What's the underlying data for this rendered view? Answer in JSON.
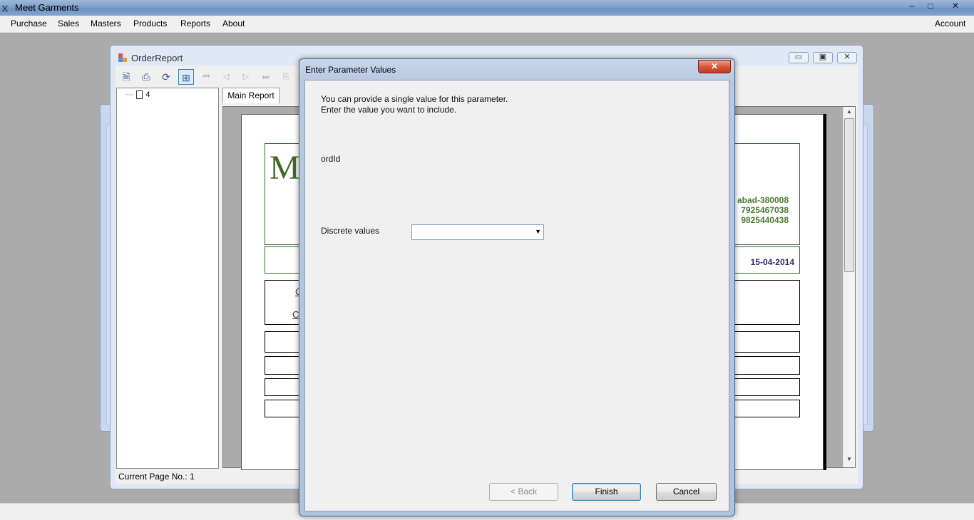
{
  "app": {
    "title": "Meet Garments",
    "window_buttons": [
      "–",
      "□",
      "✕"
    ]
  },
  "menu": {
    "items": [
      "Purchase",
      "Sales",
      "Masters",
      "Products",
      "Reports",
      "About"
    ],
    "account": "Account"
  },
  "report_window": {
    "title": "OrderReport",
    "tree_node": "4",
    "tab_label": "Main Report",
    "status": "Current Page No.: 1",
    "report_preview": {
      "logo_letter": "M",
      "address_line": "abad-380008",
      "phone1": "7925467038",
      "phone2": "9825440438",
      "date": "15-04-2014",
      "link1": "C",
      "link2": "C"
    }
  },
  "dialog": {
    "title": "Enter Parameter Values",
    "close_label": "✕",
    "info_line1": "You can provide a single value for this parameter.",
    "info_line2": "Enter the value you want to include.",
    "parameter_name": "ordId",
    "discrete_label": "Discrete values",
    "discrete_value": "",
    "buttons": {
      "back": "< Back",
      "finish": "Finish",
      "cancel": "Cancel"
    }
  },
  "colors": {
    "accent": "#3c7fb1",
    "report_green": "#4a7a30",
    "date_purple": "#3a2466"
  }
}
